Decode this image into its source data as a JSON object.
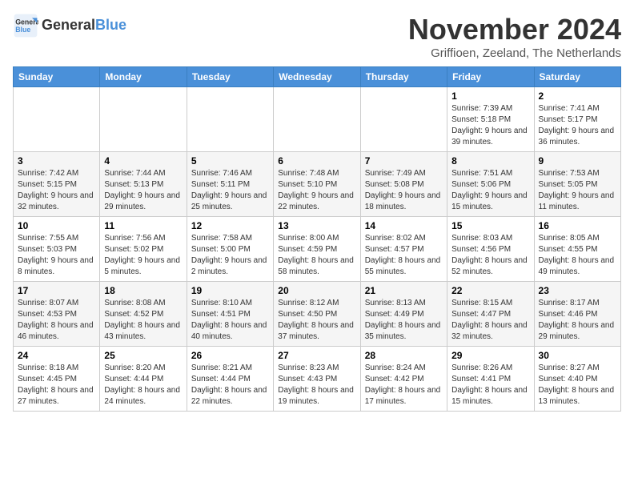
{
  "logo": {
    "line1": "General",
    "line2": "Blue"
  },
  "title": "November 2024",
  "location": "Griffioen, Zeeland, The Netherlands",
  "weekdays": [
    "Sunday",
    "Monday",
    "Tuesday",
    "Wednesday",
    "Thursday",
    "Friday",
    "Saturday"
  ],
  "weeks": [
    [
      {
        "day": "",
        "info": ""
      },
      {
        "day": "",
        "info": ""
      },
      {
        "day": "",
        "info": ""
      },
      {
        "day": "",
        "info": ""
      },
      {
        "day": "",
        "info": ""
      },
      {
        "day": "1",
        "info": "Sunrise: 7:39 AM\nSunset: 5:18 PM\nDaylight: 9 hours and 39 minutes."
      },
      {
        "day": "2",
        "info": "Sunrise: 7:41 AM\nSunset: 5:17 PM\nDaylight: 9 hours and 36 minutes."
      }
    ],
    [
      {
        "day": "3",
        "info": "Sunrise: 7:42 AM\nSunset: 5:15 PM\nDaylight: 9 hours and 32 minutes."
      },
      {
        "day": "4",
        "info": "Sunrise: 7:44 AM\nSunset: 5:13 PM\nDaylight: 9 hours and 29 minutes."
      },
      {
        "day": "5",
        "info": "Sunrise: 7:46 AM\nSunset: 5:11 PM\nDaylight: 9 hours and 25 minutes."
      },
      {
        "day": "6",
        "info": "Sunrise: 7:48 AM\nSunset: 5:10 PM\nDaylight: 9 hours and 22 minutes."
      },
      {
        "day": "7",
        "info": "Sunrise: 7:49 AM\nSunset: 5:08 PM\nDaylight: 9 hours and 18 minutes."
      },
      {
        "day": "8",
        "info": "Sunrise: 7:51 AM\nSunset: 5:06 PM\nDaylight: 9 hours and 15 minutes."
      },
      {
        "day": "9",
        "info": "Sunrise: 7:53 AM\nSunset: 5:05 PM\nDaylight: 9 hours and 11 minutes."
      }
    ],
    [
      {
        "day": "10",
        "info": "Sunrise: 7:55 AM\nSunset: 5:03 PM\nDaylight: 9 hours and 8 minutes."
      },
      {
        "day": "11",
        "info": "Sunrise: 7:56 AM\nSunset: 5:02 PM\nDaylight: 9 hours and 5 minutes."
      },
      {
        "day": "12",
        "info": "Sunrise: 7:58 AM\nSunset: 5:00 PM\nDaylight: 9 hours and 2 minutes."
      },
      {
        "day": "13",
        "info": "Sunrise: 8:00 AM\nSunset: 4:59 PM\nDaylight: 8 hours and 58 minutes."
      },
      {
        "day": "14",
        "info": "Sunrise: 8:02 AM\nSunset: 4:57 PM\nDaylight: 8 hours and 55 minutes."
      },
      {
        "day": "15",
        "info": "Sunrise: 8:03 AM\nSunset: 4:56 PM\nDaylight: 8 hours and 52 minutes."
      },
      {
        "day": "16",
        "info": "Sunrise: 8:05 AM\nSunset: 4:55 PM\nDaylight: 8 hours and 49 minutes."
      }
    ],
    [
      {
        "day": "17",
        "info": "Sunrise: 8:07 AM\nSunset: 4:53 PM\nDaylight: 8 hours and 46 minutes."
      },
      {
        "day": "18",
        "info": "Sunrise: 8:08 AM\nSunset: 4:52 PM\nDaylight: 8 hours and 43 minutes."
      },
      {
        "day": "19",
        "info": "Sunrise: 8:10 AM\nSunset: 4:51 PM\nDaylight: 8 hours and 40 minutes."
      },
      {
        "day": "20",
        "info": "Sunrise: 8:12 AM\nSunset: 4:50 PM\nDaylight: 8 hours and 37 minutes."
      },
      {
        "day": "21",
        "info": "Sunrise: 8:13 AM\nSunset: 4:49 PM\nDaylight: 8 hours and 35 minutes."
      },
      {
        "day": "22",
        "info": "Sunrise: 8:15 AM\nSunset: 4:47 PM\nDaylight: 8 hours and 32 minutes."
      },
      {
        "day": "23",
        "info": "Sunrise: 8:17 AM\nSunset: 4:46 PM\nDaylight: 8 hours and 29 minutes."
      }
    ],
    [
      {
        "day": "24",
        "info": "Sunrise: 8:18 AM\nSunset: 4:45 PM\nDaylight: 8 hours and 27 minutes."
      },
      {
        "day": "25",
        "info": "Sunrise: 8:20 AM\nSunset: 4:44 PM\nDaylight: 8 hours and 24 minutes."
      },
      {
        "day": "26",
        "info": "Sunrise: 8:21 AM\nSunset: 4:44 PM\nDaylight: 8 hours and 22 minutes."
      },
      {
        "day": "27",
        "info": "Sunrise: 8:23 AM\nSunset: 4:43 PM\nDaylight: 8 hours and 19 minutes."
      },
      {
        "day": "28",
        "info": "Sunrise: 8:24 AM\nSunset: 4:42 PM\nDaylight: 8 hours and 17 minutes."
      },
      {
        "day": "29",
        "info": "Sunrise: 8:26 AM\nSunset: 4:41 PM\nDaylight: 8 hours and 15 minutes."
      },
      {
        "day": "30",
        "info": "Sunrise: 8:27 AM\nSunset: 4:40 PM\nDaylight: 8 hours and 13 minutes."
      }
    ]
  ]
}
